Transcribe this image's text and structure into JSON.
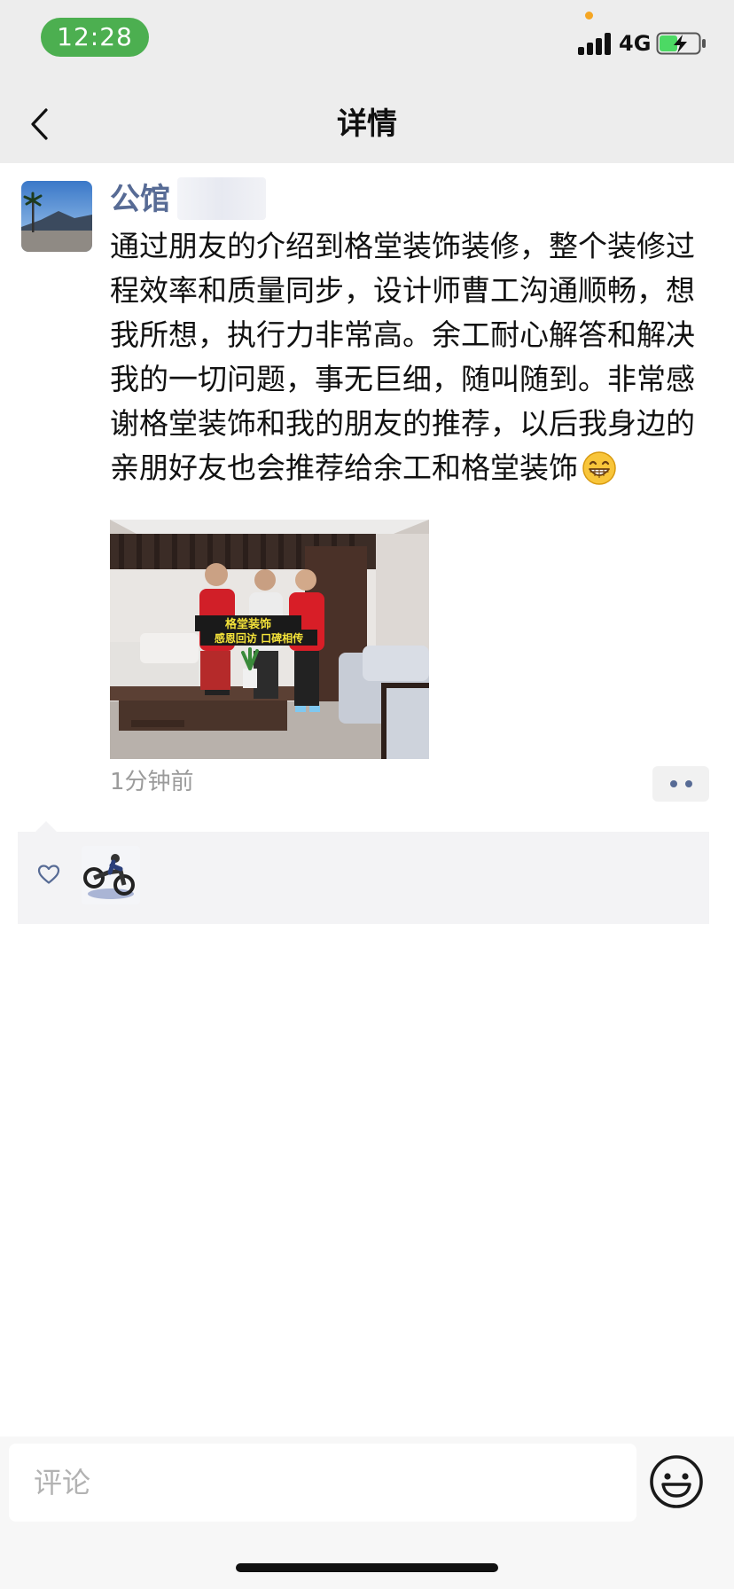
{
  "status_bar": {
    "time": "12:28",
    "network": "4G",
    "signal_icon": "signal-bars-icon",
    "battery_icon": "battery-charging-icon"
  },
  "nav": {
    "back_icon": "chevron-left-icon",
    "title": "详情"
  },
  "post": {
    "author": "公馆",
    "text": "通过朋友的介绍到格堂装饰装修，整个装修过程效率和质量同步，设计师曹工沟通顺畅，想我所想，执行力非常高。余工耐心解答和解决我的一切问题，事无巨细，随叫随到。非常感谢格堂装饰和我的朋友的推荐，以后我身边的亲朋好友也会推荐给余工和格堂装饰",
    "emoji": "grinning-face-emoji",
    "photo_banner_top": "格堂装饰",
    "photo_banner_bottom": "感恩回访 口碑相传",
    "time": "1分钟前",
    "more_icon": "more-dots-icon"
  },
  "likes": {
    "heart_icon": "heart-outline-icon",
    "avatar": "motorcycle-avatar"
  },
  "comment_bar": {
    "placeholder": "评论",
    "emoji_icon": "smiley-face-icon"
  },
  "colors": {
    "header_bg": "#ededed",
    "link_blue": "#576b95",
    "time_pill": "#4caf50",
    "muted": "#9b9b9b"
  }
}
